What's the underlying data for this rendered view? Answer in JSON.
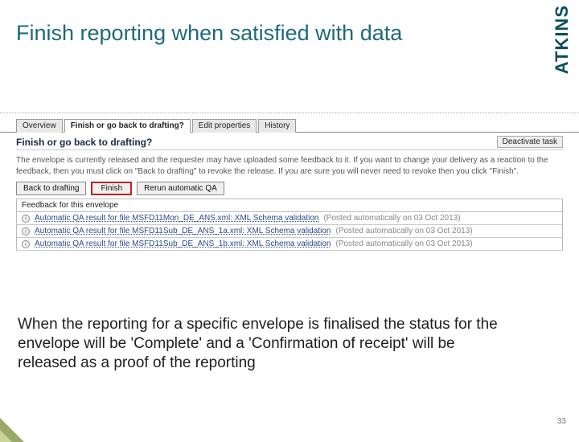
{
  "slide": {
    "title": "Finish reporting when satisfied with data",
    "logo": "ATKINS",
    "page_number": "33",
    "body_text": "When the reporting for a specific envelope is finalised the status for the envelope will be 'Complete' and a 'Confirmation of receipt' will be released as a proof of the reporting"
  },
  "app": {
    "tabs": {
      "overview": "Overview",
      "finish": "Finish or go back to drafting?",
      "edit_props": "Edit properties",
      "history": "History"
    },
    "section_title": "Finish or go back to drafting?",
    "deactivate_label": "Deactivate task",
    "description": "The envelope is currently released and the requester may have uploaded some feedback to it. If you want to change your delivery as a reaction to the feedback, then you must click on \"Back to drafting\" to revoke the release. If you are sure you will never need to revoke then you click \"Finish\".",
    "buttons": {
      "back": "Back to drafting",
      "finish": "Finish",
      "rerun": "Rerun automatic QA"
    },
    "feedback": {
      "header": "Feedback for this envelope",
      "items": [
        {
          "link": "Automatic QA result for file MSFD11Mon_DE_ANS.xml: XML Schema validation",
          "meta": "(Posted automatically on 03 Oct 2013)"
        },
        {
          "link": "Automatic QA result for file MSFD11Sub_DE_ANS_1a.xml: XML Schema validation",
          "meta": "(Posted automatically on 03 Oct 2013)"
        },
        {
          "link": "Automatic QA result for file MSFD11Sub_DE_ANS_1b.xml: XML Schema validation",
          "meta": "(Posted automatically on 03 Oct 2013)"
        }
      ]
    }
  }
}
